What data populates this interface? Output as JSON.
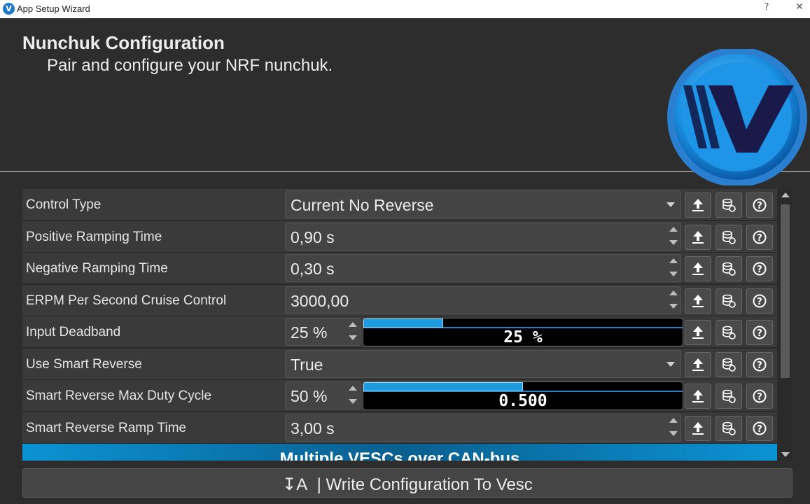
{
  "window": {
    "title": "App Setup Wizard",
    "help_glyph": "?",
    "close_glyph": "✕"
  },
  "header": {
    "title": "Nunchuk Configuration",
    "subtitle": "Pair and configure your NRF nunchuk."
  },
  "rows": [
    {
      "label": "Control Type",
      "value": "Current No Reverse",
      "kind": "combo"
    },
    {
      "label": "Positive Ramping Time",
      "value": "0,90 s",
      "kind": "spin"
    },
    {
      "label": "Negative Ramping Time",
      "value": "0,30 s",
      "kind": "spin"
    },
    {
      "label": "ERPM Per Second Cruise Control",
      "value": "3000,00",
      "kind": "spin"
    },
    {
      "label": "Input Deadband",
      "value": "25 %",
      "kind": "bar",
      "bar_text": "25 %",
      "bar_fraction": 0.25
    },
    {
      "label": "Use Smart Reverse",
      "value": "True",
      "kind": "combo"
    },
    {
      "label": "Smart Reverse Max Duty Cycle",
      "value": "50 %",
      "kind": "bar",
      "bar_text": "0.500",
      "bar_fraction": 0.5
    },
    {
      "label": "Smart Reverse Ramp Time",
      "value": "3,00 s",
      "kind": "spin"
    }
  ],
  "section_banner": "Multiple VESCs over CAN-bus",
  "write_button": {
    "icon": "↧A",
    "label": "| Write Configuration To Vesc"
  },
  "colors": {
    "accent": "#1e9bdc",
    "background": "#2d2d2d",
    "row": "#3a3a3a"
  },
  "icons": {
    "row_buttons": [
      "upload-icon",
      "database-restore-icon",
      "help-icon"
    ]
  }
}
